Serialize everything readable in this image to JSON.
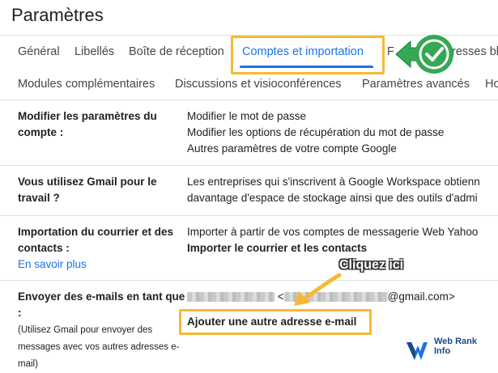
{
  "page": {
    "title": "Paramètres"
  },
  "tabs_row1": [
    {
      "label": "Général"
    },
    {
      "label": "Libellés"
    },
    {
      "label": "Boîte de réception"
    },
    {
      "label": "Comptes et importation"
    },
    {
      "label": "resses bl"
    }
  ],
  "tabs_row2": [
    {
      "label": "Modules complémentaires"
    },
    {
      "label": "Discussions et visioconférences"
    },
    {
      "label": "Paramètres avancés"
    },
    {
      "label": "Ho"
    }
  ],
  "rows": {
    "modify": {
      "label": "Modifier les paramètres du compte :",
      "links": [
        "Modifier le mot de passe",
        "Modifier les options de récupération du mot de passe",
        "Autres paramètres de votre compte Google"
      ]
    },
    "work": {
      "label": "Vous utilisez Gmail pour le travail ?",
      "line1": "Les entreprises qui s'inscrivent à Google Workspace obtienn",
      "line2": "davantage d'espace de stockage ainsi que des outils d'admi"
    },
    "import": {
      "label": "Importation du courrier et des contacts :",
      "learn_more": "En savoir plus",
      "line1": "Importer à partir de vos comptes de messagerie Web Yahoo",
      "link": "Importer le courrier et les contacts"
    },
    "send_as": {
      "label": "Envoyer des e-mails en tant que :",
      "note": "(Utilisez Gmail pour envoyer des messages avec vos autres adresses e-mail)",
      "lt": "<",
      "email_suffix": "@gmail.com>",
      "add_link": "Ajouter une autre adresse e-mail"
    }
  },
  "annotation": {
    "callout": "Cliquez ici"
  },
  "watermark": {
    "brand": "Web Rank Info"
  },
  "colors": {
    "link": "#1a73e8",
    "highlight": "#f6b933",
    "check_green": "#34a853"
  },
  "icons": {
    "check": "check-circle-icon",
    "arrow": "arrow-icon"
  }
}
